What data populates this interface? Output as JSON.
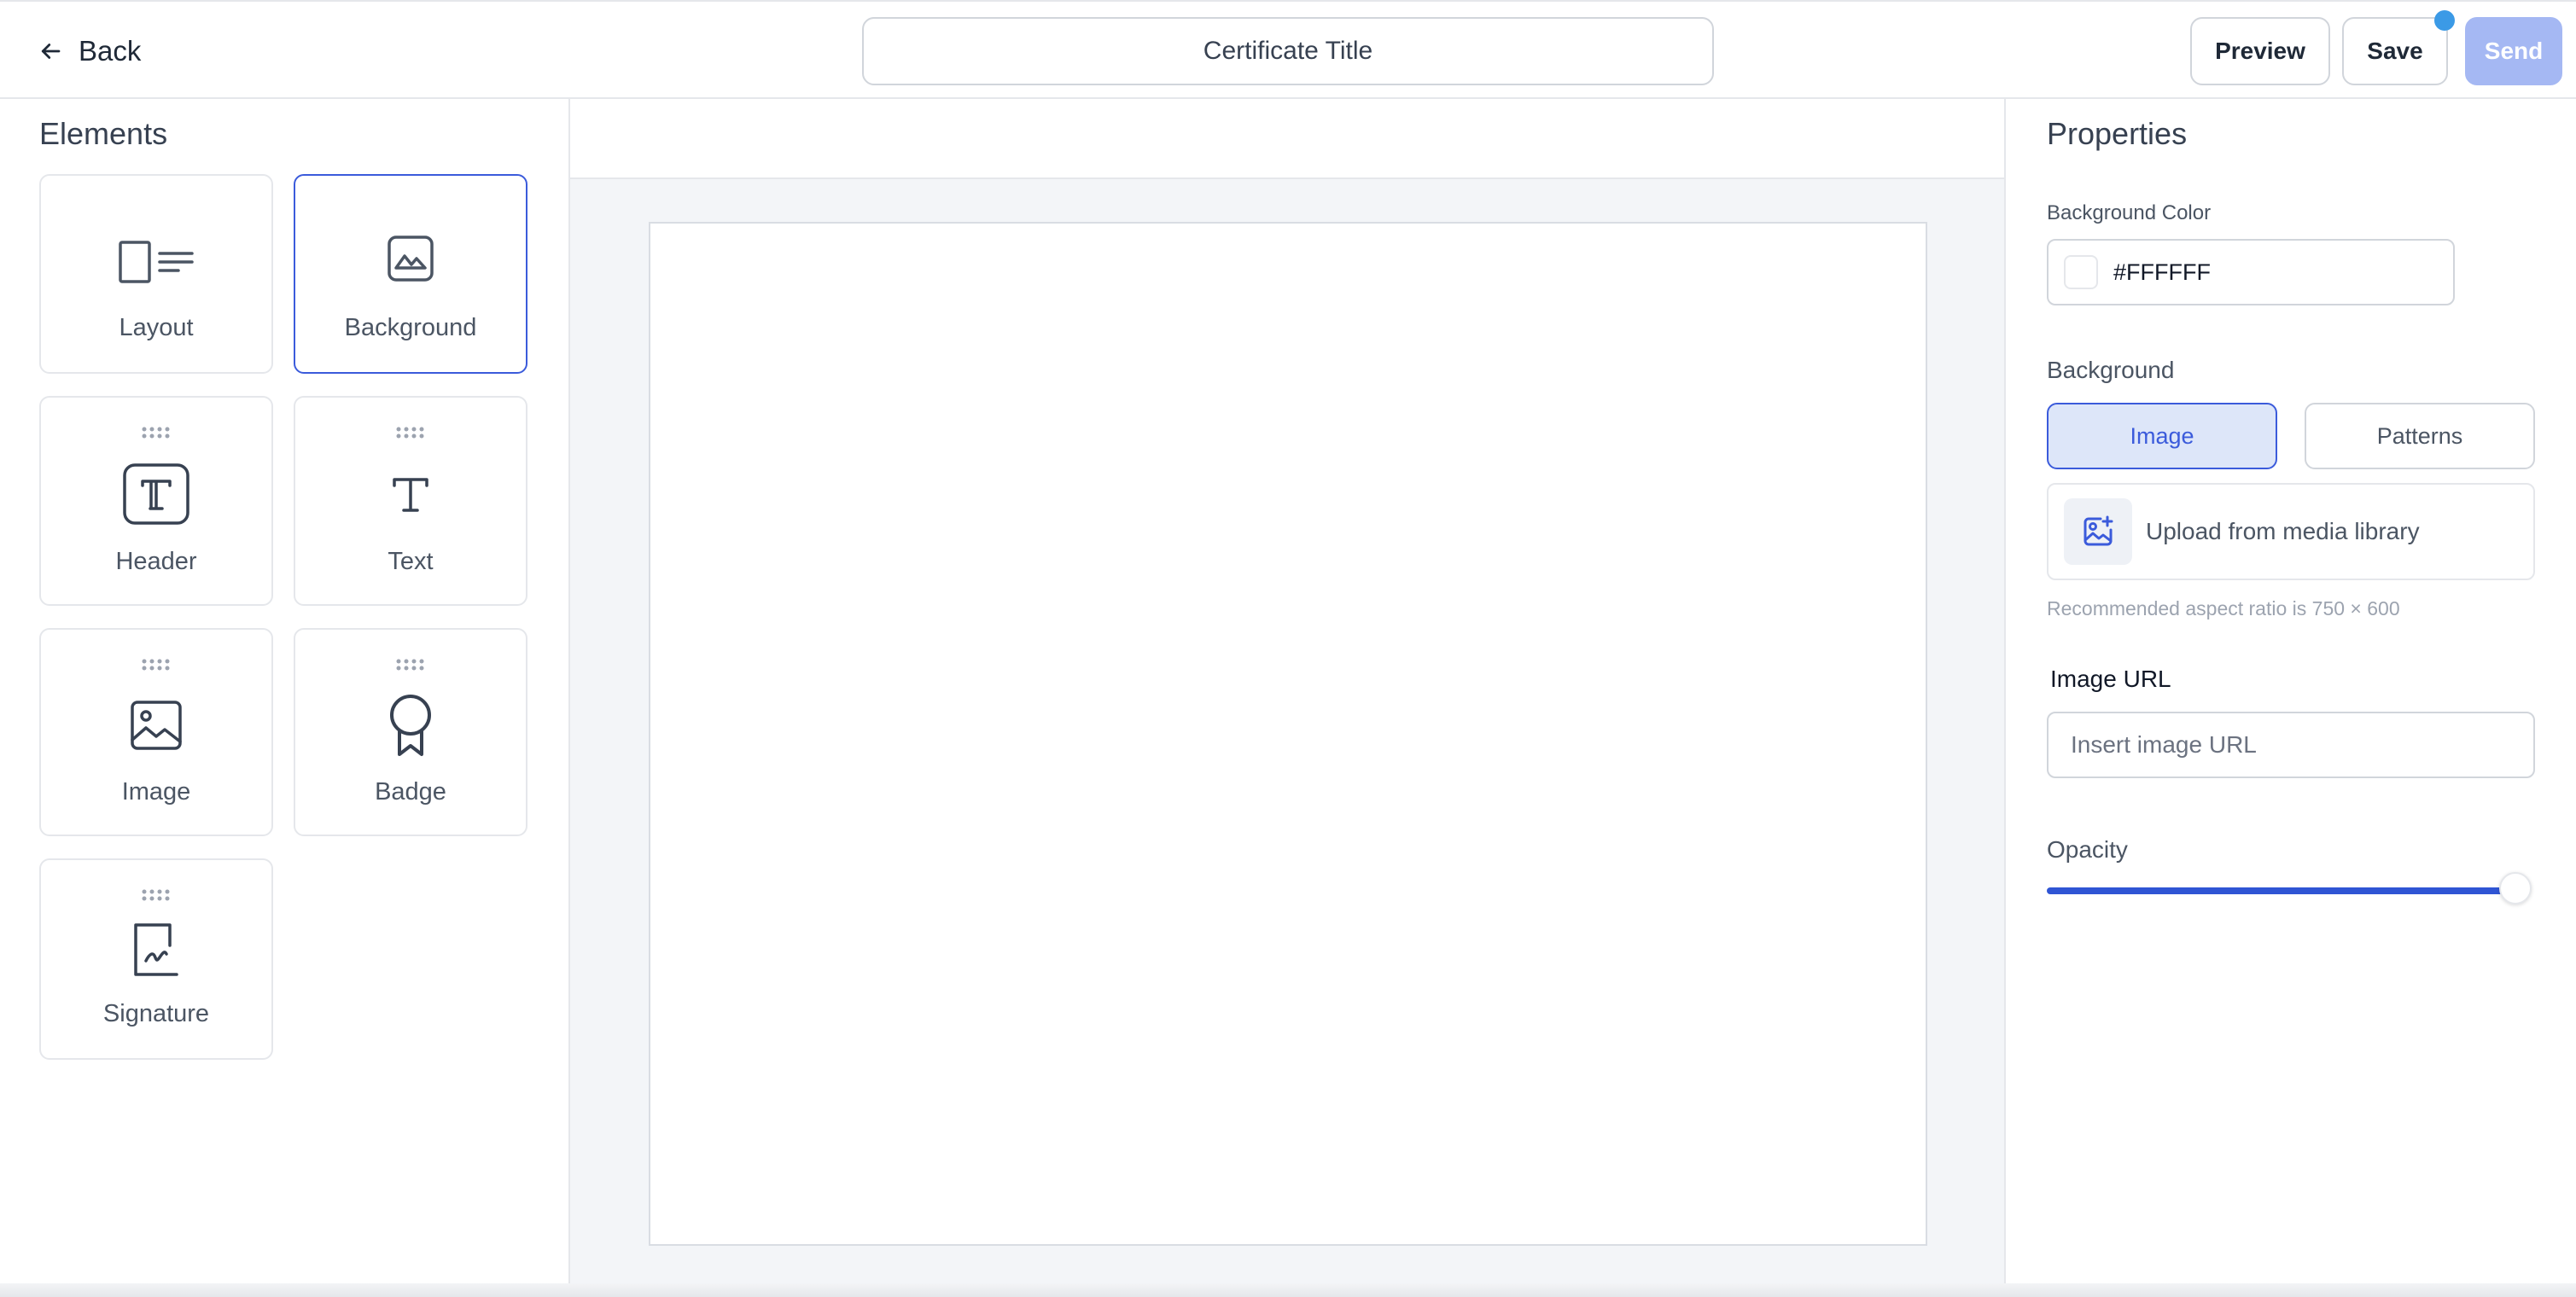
{
  "header": {
    "back_label": "Back",
    "title": "Certificate Title",
    "preview_label": "Preview",
    "save_label": "Save",
    "send_label": "Send"
  },
  "elements_panel": {
    "title": "Elements",
    "items": [
      {
        "label": "Layout",
        "icon": "layout-icon",
        "selected": false
      },
      {
        "label": "Background",
        "icon": "background-image-icon",
        "selected": true
      },
      {
        "label": "Header",
        "icon": "header-text-icon",
        "selected": false
      },
      {
        "label": "Text",
        "icon": "text-icon",
        "selected": false
      },
      {
        "label": "Image",
        "icon": "image-icon",
        "selected": false
      },
      {
        "label": "Badge",
        "icon": "badge-icon",
        "selected": false
      },
      {
        "label": "Signature",
        "icon": "signature-icon",
        "selected": false
      }
    ]
  },
  "properties_panel": {
    "title": "Properties",
    "background_color_label": "Background Color",
    "background_color_value": "#FFFFFF",
    "background_label": "Background",
    "tabs": [
      {
        "label": "Image",
        "active": true
      },
      {
        "label": "Patterns",
        "active": false
      }
    ],
    "upload_label": "Upload from media library",
    "hint": "Recommended aspect ratio is 750 × 600",
    "image_url_label": "Image URL",
    "image_url_placeholder": "Insert image URL",
    "opacity_label": "Opacity",
    "opacity_value": 1.0
  },
  "colors": {
    "accent": "#3b5bdb",
    "send_disabled": "#a5b8f3",
    "notification_dot": "#3b9ae6"
  }
}
